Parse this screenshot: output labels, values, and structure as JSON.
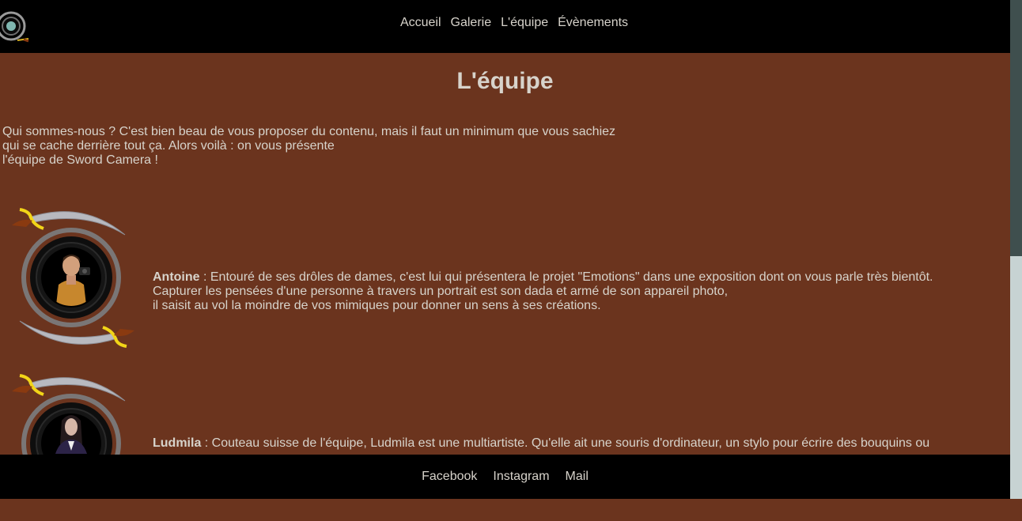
{
  "header": {
    "logo": "sword-camera-logo",
    "nav": [
      "Accueil",
      "Galerie",
      "L'équipe",
      "Évènements"
    ]
  },
  "main": {
    "title": "L'équipe",
    "intro": [
      "Qui sommes-nous ? C'est bien beau de vous proposer du contenu, mais il faut un minimum que vous sachiez",
      "qui se cache derrière tout ça. Alors voilà : on vous présente",
      "l'équipe de Sword Camera !"
    ],
    "members": [
      {
        "name": "Antoine",
        "lines": [
          " : Entouré de ses drôles de dames, c'est lui qui présentera le projet \"Emotions\" dans une exposition dont on vous parle très bientôt.",
          "Capturer les pensées d'une personne à travers un portrait est son dada et armé de son appareil photo,",
          "il saisit au vol la moindre de vos mimiques pour donner un sens à ses créations."
        ]
      },
      {
        "name": "Ludmila",
        "lines": [
          " : Couteau suisse de l'équipe, Ludmila est une multiartiste. Qu'elle ait une souris d'ordinateur, un stylo pour écrire des bouquins ou"
        ]
      }
    ]
  },
  "footer": {
    "links": [
      "Facebook",
      "Instagram",
      "Mail"
    ]
  },
  "colors": {
    "background": "#6b341e",
    "bars": "#000000",
    "text": "#d7d3cb",
    "accent_yellow": "#f2d518",
    "blade": "#a9abb3"
  }
}
